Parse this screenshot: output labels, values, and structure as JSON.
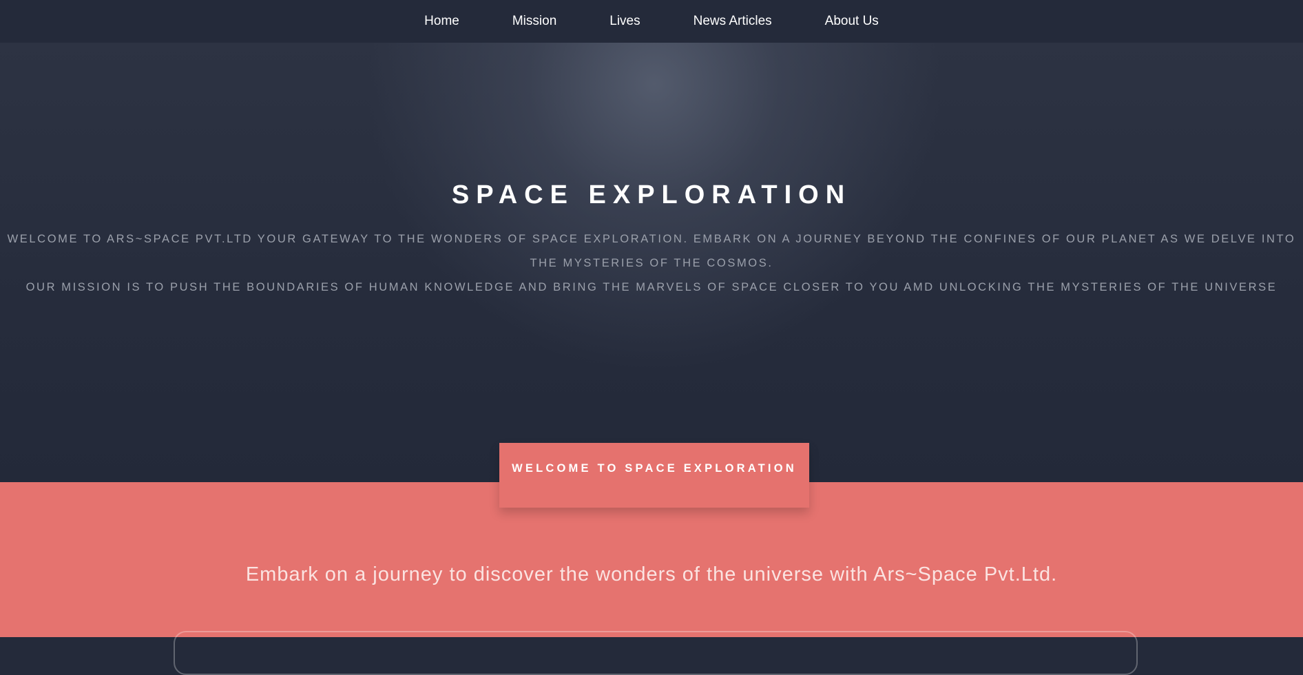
{
  "nav": {
    "items": [
      {
        "label": "Home"
      },
      {
        "label": "Mission"
      },
      {
        "label": "Lives"
      },
      {
        "label": "News Articles"
      },
      {
        "label": "About Us"
      }
    ]
  },
  "hero": {
    "title": "SPACE EXPLORATION",
    "paragraph_1": "WELCOME TO ARS~SPACE PVT.LTD YOUR GATEWAY TO THE WONDERS OF SPACE EXPLORATION. EMBARK ON A JOURNEY BEYOND THE CONFINES OF OUR PLANET AS WE DELVE INTO THE MYSTERIES OF THE COSMOS.",
    "paragraph_2": "OUR MISSION IS TO PUSH THE BOUNDARIES OF HUMAN KNOWLEDGE AND BRING THE MARVELS OF SPACE CLOSER TO YOU AMD UNLOCKING THE MYSTERIES OF THE UNIVERSE"
  },
  "welcome_tab": {
    "label": "WELCOME TO SPACE EXPLORATION"
  },
  "section": {
    "tagline": "Embark on a journey to discover the wonders of the universe with Ars~Space Pvt.Ltd."
  },
  "colors": {
    "nav_bg": "#242a3a",
    "hero_bg": "#262c3c",
    "accent_coral": "#e5736f",
    "title_text": "#ffffff",
    "muted_text": "#9ba0ab"
  }
}
